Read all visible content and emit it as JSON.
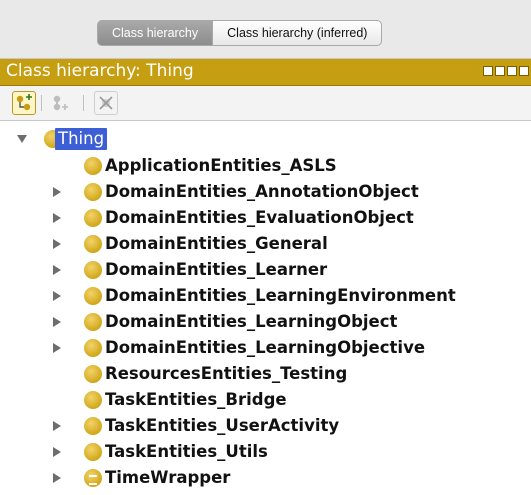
{
  "tabs": [
    {
      "label": "Class hierarchy",
      "active": true
    },
    {
      "label": "Class hierarchy (inferred)",
      "active": false
    }
  ],
  "panel": {
    "title": "Class hierarchy: Thing",
    "accent_color": "#c69e11",
    "window_controls": [
      "view-icon",
      "minimize-icon",
      "maximize-icon",
      "close-icon"
    ]
  },
  "toolbar": {
    "buttons": [
      "add-subclass-icon",
      "add-sibling-class-icon",
      "delete-class-icon"
    ]
  },
  "tree": {
    "root": {
      "label": "Thing",
      "expanded": true,
      "selected": true
    },
    "items": [
      {
        "label": "ApplicationEntities_ASLS",
        "has_children": false
      },
      {
        "label": "DomainEntities_AnnotationObject",
        "has_children": true
      },
      {
        "label": "DomainEntities_EvaluationObject",
        "has_children": true
      },
      {
        "label": "DomainEntities_General",
        "has_children": true
      },
      {
        "label": "DomainEntities_Learner",
        "has_children": true
      },
      {
        "label": "DomainEntities_LearningEnvironment",
        "has_children": true
      },
      {
        "label": "DomainEntities_LearningObject",
        "has_children": true
      },
      {
        "label": "DomainEntities_LearningObjective",
        "has_children": true
      },
      {
        "label": "ResourcesEntities_Testing",
        "has_children": false
      },
      {
        "label": "TaskEntities_Bridge",
        "has_children": false
      },
      {
        "label": "TaskEntities_UserActivity",
        "has_children": true
      },
      {
        "label": "TaskEntities_Utils",
        "has_children": true
      },
      {
        "label": "TimeWrapper",
        "has_children": true,
        "equivalent_class": true
      }
    ]
  }
}
